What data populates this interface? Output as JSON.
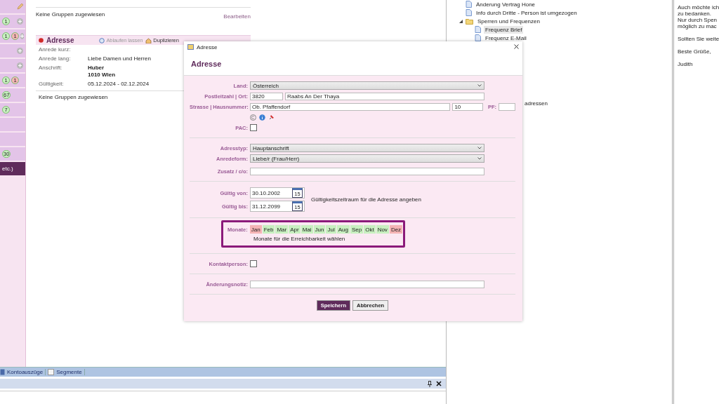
{
  "sidebar": {
    "tiles": [
      {
        "kind": "edit",
        "selected": false,
        "add_button": false
      },
      {
        "kind": "counts",
        "selected": false,
        "add_button": true,
        "badges": [
          {
            "text": "1",
            "color": "#c8f0c0"
          }
        ]
      },
      {
        "kind": "counts",
        "selected": false,
        "add_button": true,
        "badges": [
          {
            "text": "1",
            "color": "#c8f0c0"
          },
          {
            "text": "1",
            "color": "#f4b4b4"
          }
        ]
      },
      {
        "kind": "counts",
        "selected": false,
        "add_button": true
      },
      {
        "kind": "counts",
        "selected": false,
        "add_button": true
      },
      {
        "kind": "counts",
        "selected": false,
        "add_button": false,
        "badges": [
          {
            "text": "1",
            "color": "#c8f0c0"
          },
          {
            "text": "1",
            "color": "#f4b4b4"
          }
        ]
      },
      {
        "kind": "counts",
        "selected": false,
        "add_button": false,
        "badges": [
          {
            "text": "67",
            "color": "#c8f0c0"
          }
        ]
      },
      {
        "kind": "counts",
        "selected": false,
        "add_button": false,
        "badges": [
          {
            "text": "7",
            "color": "#c8f0c0"
          }
        ]
      },
      {
        "kind": "counts",
        "selected": false,
        "add_button": false
      },
      {
        "kind": "counts",
        "selected": false,
        "add_button": false
      },
      {
        "kind": "counts",
        "selected": false,
        "add_button": false,
        "badges": [
          {
            "text": "30",
            "color": "#c8f0c0"
          }
        ]
      },
      {
        "kind": "label",
        "selected": true,
        "add_button": false,
        "label": "etc.)"
      }
    ]
  },
  "groups_top": {
    "text": "Keine Gruppen zugewiesen",
    "edit_link": "Bearbeiten"
  },
  "address_card": {
    "title": "Adresse",
    "actions": [
      {
        "label": "Ablaufen lassen",
        "disabled": true
      },
      {
        "label": "Duplizieren",
        "disabled": false
      }
    ],
    "fields": [
      {
        "label": "Anrede kurz:"
      },
      {
        "label": "Anrede lang:",
        "lines": [
          "Liebe Damen und Herren"
        ],
        "bold": false
      },
      {
        "label": "Anschrift:",
        "lines": [
          "Huber",
          "1010 Wien"
        ],
        "bold": true
      },
      {
        "label": "Gültigkeit:",
        "lines": [
          "05.12.2024 - 02.12.2024"
        ],
        "bold": false
      }
    ],
    "groups": "Keine Gruppen zugewiesen"
  },
  "bottom_tabs": [
    {
      "label": "Kontoauszüge",
      "kind": "book"
    },
    {
      "label": "Segmente",
      "kind": "page"
    }
  ],
  "tree": [
    {
      "label": "Änderung Vertrag Hone",
      "kind": "doc",
      "selected": false
    },
    {
      "label": "Info durch Dritte - Person ist umgezogen",
      "kind": "doc",
      "selected": false
    },
    {
      "label": "Sperren und Frequenzen",
      "kind": "folder",
      "selected": false,
      "expanded": true,
      "children": [
        {
          "label": "Frequenz Brief",
          "kind": "doc",
          "selected": true
        },
        {
          "label": "Frequenz E-Mail",
          "kind": "doc",
          "selected": false
        }
      ]
    },
    {
      "label": "adressen",
      "kind": "covered",
      "selected": false
    }
  ],
  "email_paragraphs": [
    [
      "Auch möchte ich",
      "zu bedanken.",
      "Nur durch Spen",
      "möglich zu mac"
    ],
    [
      "Sollten Sie weite"
    ],
    [
      "Beste Grüße,"
    ],
    [
      "Judith"
    ]
  ],
  "dialog": {
    "window_title": "Adresse",
    "heading": "Adresse",
    "land": {
      "label": "Land:",
      "value": "Österreich"
    },
    "plz": {
      "label": "Postleitzahl | Ort:",
      "zip": "3820",
      "city": "Raabs An Der Thaya"
    },
    "street": {
      "label": "Strasse | Hausnummer:",
      "street": "Ob. Pfaffendorf",
      "number": "10",
      "pf_label": "PF:"
    },
    "pac": {
      "label": "PAC:",
      "checked": false
    },
    "adresstyp": {
      "label": "Adresstyp:",
      "value": "Hauptanschrift"
    },
    "anredeform": {
      "label": "Anredeform:",
      "value": "Liebe/r (Frau/Herr)"
    },
    "zusatz": {
      "label": "Zusatz / c/o:"
    },
    "valid_from": {
      "label": "Gültig von:",
      "value": "30.10.2002",
      "calendar_day": "15"
    },
    "valid_to": {
      "label": "Gültig bis:",
      "value": "31.12.2099",
      "calendar_day": "15"
    },
    "validity_hint": "Gültigkeitszeitraum für die Adresse angeben",
    "months": {
      "label": "Monate:",
      "hint": "Monate für die Erreichbarkeit wählen",
      "items": [
        {
          "label": "Jan",
          "selected": false
        },
        {
          "label": "Feb",
          "selected": true
        },
        {
          "label": "Mar",
          "selected": true
        },
        {
          "label": "Apr",
          "selected": true
        },
        {
          "label": "Mai",
          "selected": true
        },
        {
          "label": "Jun",
          "selected": true
        },
        {
          "label": "Jul",
          "selected": true
        },
        {
          "label": "Aug",
          "selected": true
        },
        {
          "label": "Sep",
          "selected": true
        },
        {
          "label": "Okt",
          "selected": true
        },
        {
          "label": "Nov",
          "selected": true
        },
        {
          "label": "Dez",
          "selected": false
        }
      ]
    },
    "contact": {
      "label": "Kontaktperson:",
      "checked": false
    },
    "note": {
      "label": "Änderungsnotiz:"
    },
    "buttons": [
      {
        "label": "Speichern",
        "primary": true
      },
      {
        "label": "Abbrechen",
        "primary": false
      }
    ]
  }
}
